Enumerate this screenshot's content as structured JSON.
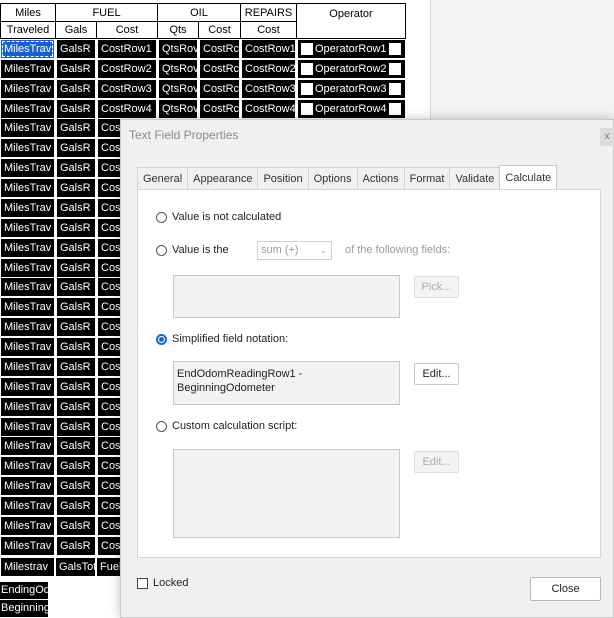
{
  "form": {
    "headers": {
      "miles_top": "Miles",
      "miles_bottom": "Traveled",
      "fuel": "FUEL",
      "fuel_gals": "Gals",
      "fuel_cost": "Cost",
      "oil": "OIL",
      "oil_qts": "Qts",
      "oil_cost": "Cost",
      "repairs": "REPAIRS",
      "repairs_cost": "Cost",
      "operator": "Operator"
    },
    "rows_full": [
      {
        "miles": "MilesTrav",
        "gals": "GalsR",
        "cost": "CostRow1",
        "qts": "QtsRov",
        "oilcost": "CostRc",
        "repcost": "CostRow1",
        "operator": "OperatorRow1"
      },
      {
        "miles": "MilesTrav",
        "gals": "GalsR",
        "cost": "CostRow2",
        "qts": "QtsRov",
        "oilcost": "CostRc",
        "repcost": "CostRow2",
        "operator": "OperatorRow2"
      },
      {
        "miles": "MilesTrav",
        "gals": "GalsR",
        "cost": "CostRow3",
        "qts": "QtsRov",
        "oilcost": "CostRc",
        "repcost": "CostRow3",
        "operator": "OperatorRow3"
      },
      {
        "miles": "MilesTrav",
        "gals": "GalsR",
        "cost": "CostRow4",
        "qts": "QtsRov",
        "oilcost": "CostRc",
        "repcost": "CostRow4",
        "operator": "OperatorRow4"
      }
    ],
    "rows_partial": [
      {
        "miles": "MilesTrav",
        "gals": "GalsR",
        "cost": "Cos"
      },
      {
        "miles": "MilesTrav",
        "gals": "GalsR",
        "cost": "Cos"
      },
      {
        "miles": "MilesTrav",
        "gals": "GalsR",
        "cost": "Cos"
      },
      {
        "miles": "MilesTrav",
        "gals": "GalsR",
        "cost": "Cos"
      },
      {
        "miles": "MilesTrav",
        "gals": "GalsR",
        "cost": "Cos"
      },
      {
        "miles": "MilesTrav",
        "gals": "GalsR",
        "cost": "Cost"
      },
      {
        "miles": "MilesTrav",
        "gals": "GalsR",
        "cost": "Cost"
      },
      {
        "miles": "MilesTrav",
        "gals": "GalsR",
        "cost": "Cost"
      },
      {
        "miles": "MilesTrav",
        "gals": "GalsR",
        "cost": "Cost"
      },
      {
        "miles": "MilesTrav",
        "gals": "GalsR",
        "cost": "Cost"
      },
      {
        "miles": "MilesTrav",
        "gals": "GalsR",
        "cost": "Cost"
      },
      {
        "miles": "MilesTrav",
        "gals": "GalsR",
        "cost": "Cost"
      },
      {
        "miles": "MilesTrav",
        "gals": "GalsR",
        "cost": "Cost"
      },
      {
        "miles": "MilesTrav",
        "gals": "GalsR",
        "cost": "Cost"
      },
      {
        "miles": "MilesTrav",
        "gals": "GalsR",
        "cost": "Cost"
      },
      {
        "miles": "MilesTrav",
        "gals": "GalsR",
        "cost": "Cost"
      },
      {
        "miles": "MilesTrav",
        "gals": "GalsR",
        "cost": "Cost"
      },
      {
        "miles": "MilesTrav",
        "gals": "GalsR",
        "cost": "Cost"
      },
      {
        "miles": "MilesTrav",
        "gals": "GalsR",
        "cost": "Cost"
      },
      {
        "miles": "MilesTrav",
        "gals": "GalsR",
        "cost": "Cost"
      },
      {
        "miles": "MilesTrav",
        "gals": "GalsR",
        "cost": "Cost"
      },
      {
        "miles": "MilesTrav",
        "gals": "GalsR",
        "cost": "Cost"
      }
    ],
    "totals": {
      "miles": "Milestrav",
      "gals": "GalsTot",
      "cost": "Fuel"
    },
    "bottom_fields": [
      "EndingOd",
      "Beginning"
    ]
  },
  "dialog": {
    "title": "Text Field Properties",
    "close_glyph": "x",
    "tabs": [
      "General",
      "Appearance",
      "Position",
      "Options",
      "Actions",
      "Format",
      "Validate",
      "Calculate"
    ],
    "active_tab": "Calculate",
    "opt_not_calculated": "Value is not calculated",
    "opt_value_is": "Value is the",
    "function_select": "sum (+)",
    "of_following": "of the following fields:",
    "pick_button": "Pick...",
    "opt_simplified": "Simplified field notation:",
    "simplified_value": "EndOdomReadingRow1 - BeginningOdometer",
    "edit_button_1": "Edit...",
    "opt_custom": "Custom calculation script:",
    "edit_button_2": "Edit...",
    "locked_label": "Locked",
    "close_button": "Close",
    "selected_option": "simplified"
  }
}
